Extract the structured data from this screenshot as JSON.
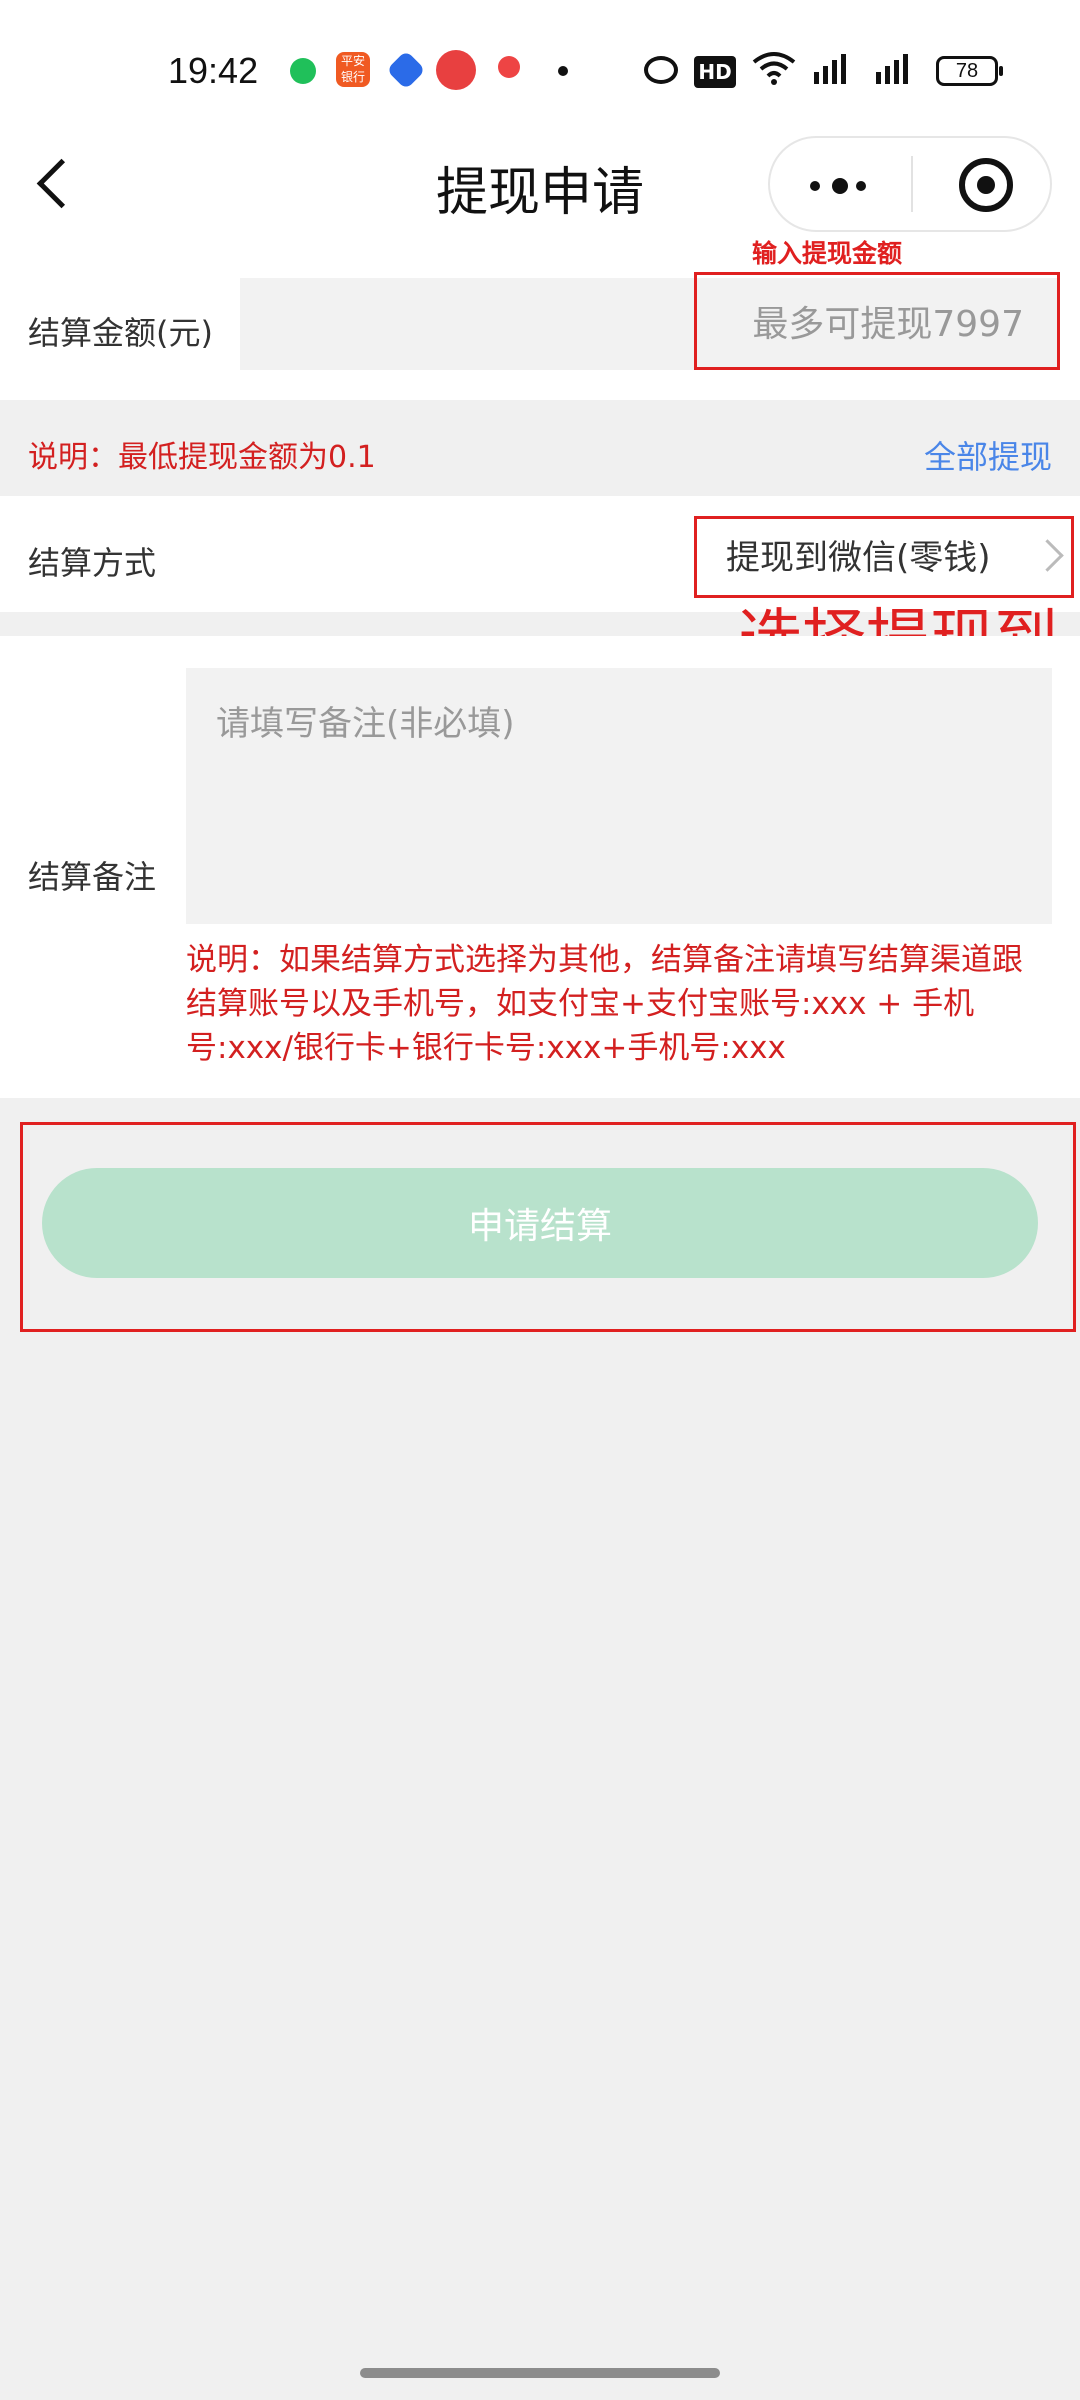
{
  "status_bar": {
    "time": "19:42",
    "app2_label": "平安\n银行",
    "hd_label": "HD",
    "battery": "78",
    "icons": [
      "wechat-like-icon",
      "pingan-bank-icon",
      "app-icon",
      "jd-icon",
      "location-icon",
      "alarm-icon",
      "hd-icon",
      "wifi-icon",
      "signal-5g-icon",
      "signal-5g-icon",
      "battery-icon"
    ]
  },
  "nav": {
    "title": "提现申请"
  },
  "amount": {
    "annotation": "输入提现金额",
    "label": "结算金额(元)",
    "placeholder": "最多可提现7997",
    "value": ""
  },
  "note": {
    "text": "说明：最低提现金额为0.1",
    "withdraw_all": "全部提现"
  },
  "method": {
    "label": "结算方式",
    "value": "提现到微信(零钱)",
    "annotation": "选择提现到零钱"
  },
  "remark": {
    "label": "结算备注",
    "placeholder": "请填写备注(非必填)",
    "note": "说明：如果结算方式选择为其他，结算备注请填写结算渠道跟结算账号以及手机号，如支付宝+支付宝账号:xxx + 手机号:xxx/银行卡+银行卡号:xxx+手机号:xxx"
  },
  "submit": {
    "label": "申请结算"
  },
  "colors": {
    "accent_red": "#e02020",
    "note_red": "#d32020",
    "link_blue": "#4a86e8",
    "button_green": "#b8e2cc",
    "background": "#f0f0f0"
  }
}
